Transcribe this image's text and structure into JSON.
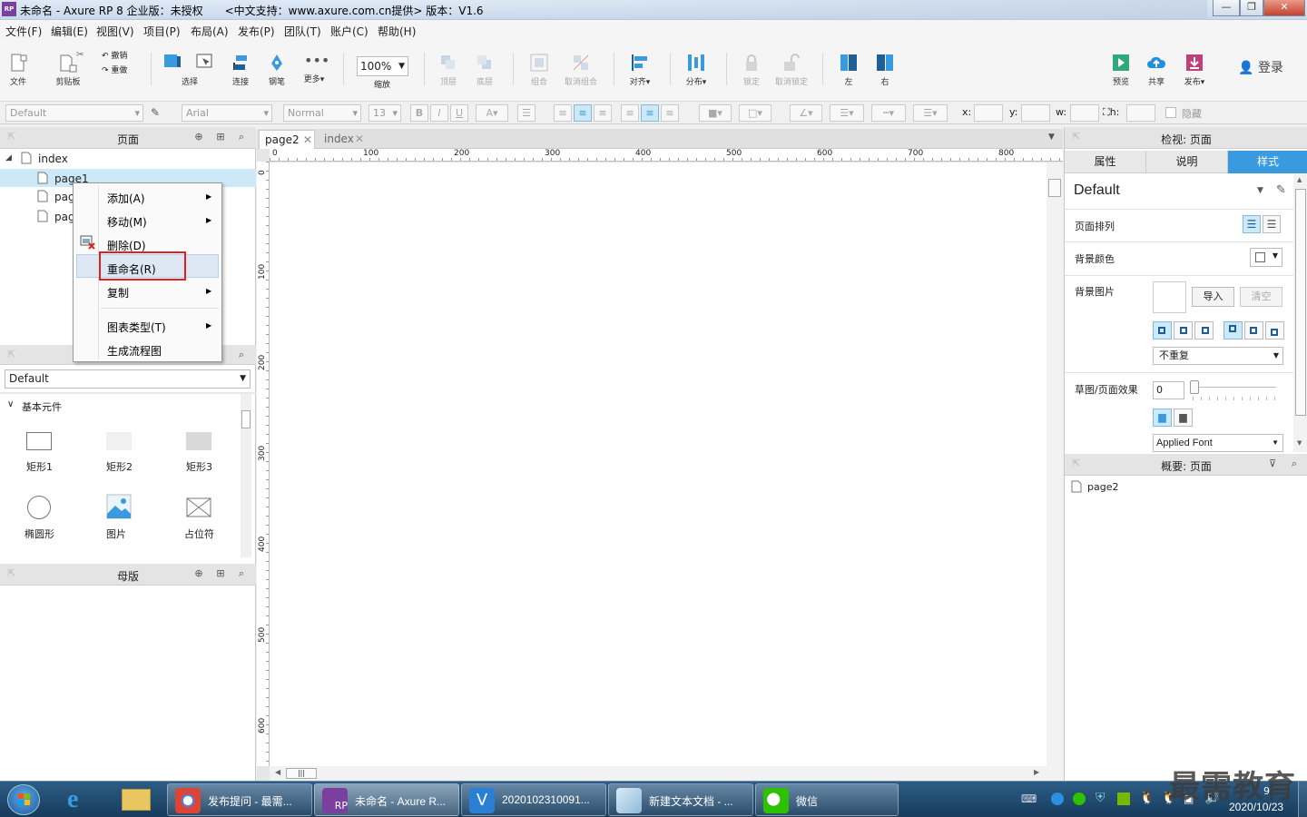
{
  "window": {
    "title": "未命名 - Axure RP 8 企业版：未授权　　<中文支持：www.axure.com.cn提供> 版本：V1.6"
  },
  "menu": [
    "文件(F)",
    "编辑(E)",
    "视图(V)",
    "项目(P)",
    "布局(A)",
    "发布(P)",
    "团队(T)",
    "账户(C)",
    "帮助(H)"
  ],
  "toolbar": {
    "file": "文件",
    "clipboard": "剪贴板",
    "undo": "撤销",
    "redo": "重做",
    "select": "选择",
    "connect": "连接",
    "pen": "钢笔",
    "more": "更多▾",
    "zoom_value": "100%",
    "zoom_label": "缩放",
    "top": "顶层",
    "bottom": "底层",
    "group": "组合",
    "ungroup": "取消组合",
    "align": "对齐▾",
    "distribute": "分布▾",
    "lock": "锁定",
    "unlock": "取消锁定",
    "left": "左",
    "right": "右",
    "preview": "预览",
    "share": "共享",
    "publish": "发布▾",
    "login": "登录"
  },
  "format": {
    "style": "Default",
    "font": "Arial",
    "weight": "Normal",
    "size": "13",
    "x_label": "x:",
    "y_label": "y:",
    "w_label": "w:",
    "h_label": "h:",
    "hide": "隐藏"
  },
  "pages_panel": {
    "title": "页面",
    "root": "index",
    "items": [
      "page1",
      "page2",
      "page3"
    ]
  },
  "context_menu": {
    "items": [
      "添加(A)",
      "移动(M)",
      "删除(D)",
      "重命名(R)",
      "复制",
      "图表类型(T)",
      "生成流程图"
    ]
  },
  "library_panel": {
    "selected": "Default",
    "group": "基本元件",
    "widgets": [
      "矩形1",
      "矩形2",
      "矩形3",
      "椭圆形",
      "图片",
      "占位符"
    ]
  },
  "masters_panel": {
    "title": "母版"
  },
  "canvas": {
    "tabs": [
      "page2",
      "index"
    ],
    "ruler_h": [
      "0",
      "100",
      "200",
      "300",
      "400",
      "500",
      "600",
      "700",
      "800"
    ],
    "ruler_v": [
      "0",
      "100",
      "200",
      "300",
      "400",
      "500",
      "600"
    ]
  },
  "inspector": {
    "title": "检视: 页面",
    "tabs": [
      "属性",
      "说明",
      "样式"
    ],
    "style_name": "Default",
    "page_align": "页面排列",
    "bg_color": "背景颜色",
    "bg_image": "背景图片",
    "import": "导入",
    "clear": "清空",
    "repeat": "不重复",
    "sketch": "草图/页面效果",
    "sketch_value": "0",
    "font": "Applied Font"
  },
  "outline_panel": {
    "title": "概要: 页面",
    "item": "page2"
  },
  "taskbar": {
    "tasks": [
      "发布提问 - 最需...",
      "未命名 - Axure R...",
      "2020102310091...",
      "新建文本文档 - ...",
      "微信"
    ],
    "date": "2020/10/23",
    "time": "9",
    "watermark": "最需教育"
  },
  "colors": {
    "accent": "#3a9ae0",
    "highlight": "#cde8f7",
    "rename_border": "#e02020"
  }
}
